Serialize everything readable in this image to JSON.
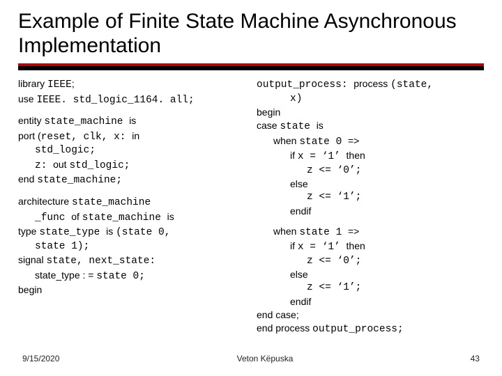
{
  "title": "Example of Finite State Machine Asynchronous Implementation",
  "left": {
    "l1a": "library ",
    "l1b": "IEEE",
    "l1c": ";",
    "l2a": "use ",
    "l2b": "IEEE. std_logic_1164. all;",
    "l3a": "entity ",
    "l3b": "state_machine ",
    "l3c": "is",
    "l4a": "port (",
    "l4b": "reset, clk, x: ",
    "l4c": "in",
    "l5": "std_logic;",
    "l6a": "z: ",
    "l6b": "out ",
    "l6c": "std_logic;",
    "l7a": "end ",
    "l7b": "state_machine;",
    "l8a": "architecture ",
    "l8b": "state_machine",
    "l9a": "_func ",
    "l9b": "of ",
    "l9c": "state_machine ",
    "l9d": "is",
    "l10a": "type ",
    "l10b": "state_type ",
    "l10c": "is ",
    "l10d": "(state 0,",
    "l11": "state 1);",
    "l12a": "signal ",
    "l12b": "state, next_state:",
    "l13a": "state_type : = ",
    "l13b": "state 0;",
    "l14": "begin"
  },
  "right": {
    "r1a": "output_process: ",
    "r1b": "process ",
    "r1c": "(state,",
    "r2": "x)",
    "r3": "begin",
    "r4a": "case ",
    "r4b": "state ",
    "r4c": "is",
    "r5a": "when ",
    "r5b": "state 0 ",
    "r5c": "=>",
    "r6a": "if ",
    "r6b": "x = ‘1’ ",
    "r6c": "then",
    "r7": "z <= ‘0’;",
    "r8": "else",
    "r9": "z <= ‘1’;",
    "r10": "endif",
    "r11a": "when ",
    "r11b": "state 1 ",
    "r11c": "=>",
    "r12a": "if ",
    "r12b": "x = ‘1’ ",
    "r12c": "then",
    "r13": "z <= ‘0’;",
    "r14": "else",
    "r15": "z <= ‘1’;",
    "r16": "endif",
    "r17": "end case;",
    "r18a": "end process ",
    "r18b": "output_process;"
  },
  "footer": {
    "date": "9/15/2020",
    "author": "Veton Këpuska",
    "pagenum": "43"
  }
}
